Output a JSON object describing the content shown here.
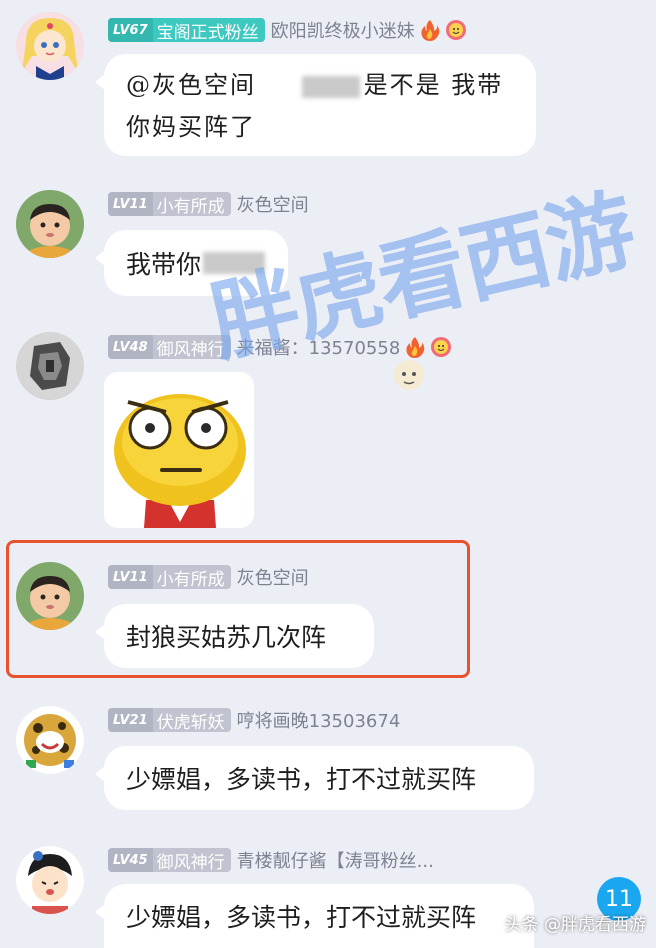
{
  "colors": {
    "background": "#eceef6",
    "bubble": "#ffffff",
    "highlight_border": "#e8532e",
    "unread_badge": "#1ba7f0",
    "watermark": "#78a5eb"
  },
  "watermark": "胖虎看西游",
  "messages": [
    {
      "level": "LV67",
      "title": "宝阁正式粉丝",
      "nickname": "欧阳凯终极小迷妹",
      "text_line1_a": "@灰色空间",
      "text_line1_b": "是不是 我带",
      "text_line2": "你妈买阵了",
      "icons": [
        "fire-icon",
        "smiley-badge-icon"
      ]
    },
    {
      "level": "LV11",
      "title": "小有所成",
      "nickname": "灰色空间",
      "text": "我带你"
    },
    {
      "level": "LV48",
      "title": "御风神行",
      "nickname": "来福酱：13570558",
      "icons": [
        "fire-icon",
        "smiley-badge-icon"
      ],
      "sticker": "shocked-emoji-sticker"
    },
    {
      "level": "LV11",
      "title": "小有所成",
      "nickname": "灰色空间",
      "text": "封狼买姑苏几次阵"
    },
    {
      "level": "LV21",
      "title": "伏虎斩妖",
      "nickname": "哼将画晚13503674",
      "text": "少嫖娼，多读书，打不过就买阵"
    },
    {
      "level": "LV45",
      "title": "御风神行",
      "nickname": "青楼靓仔酱【涛哥粉丝...",
      "text": "少嫖娼，多读书，打不过就买阵"
    }
  ],
  "unread_count": "11",
  "source_credit": "头条 @胖虎看西游"
}
